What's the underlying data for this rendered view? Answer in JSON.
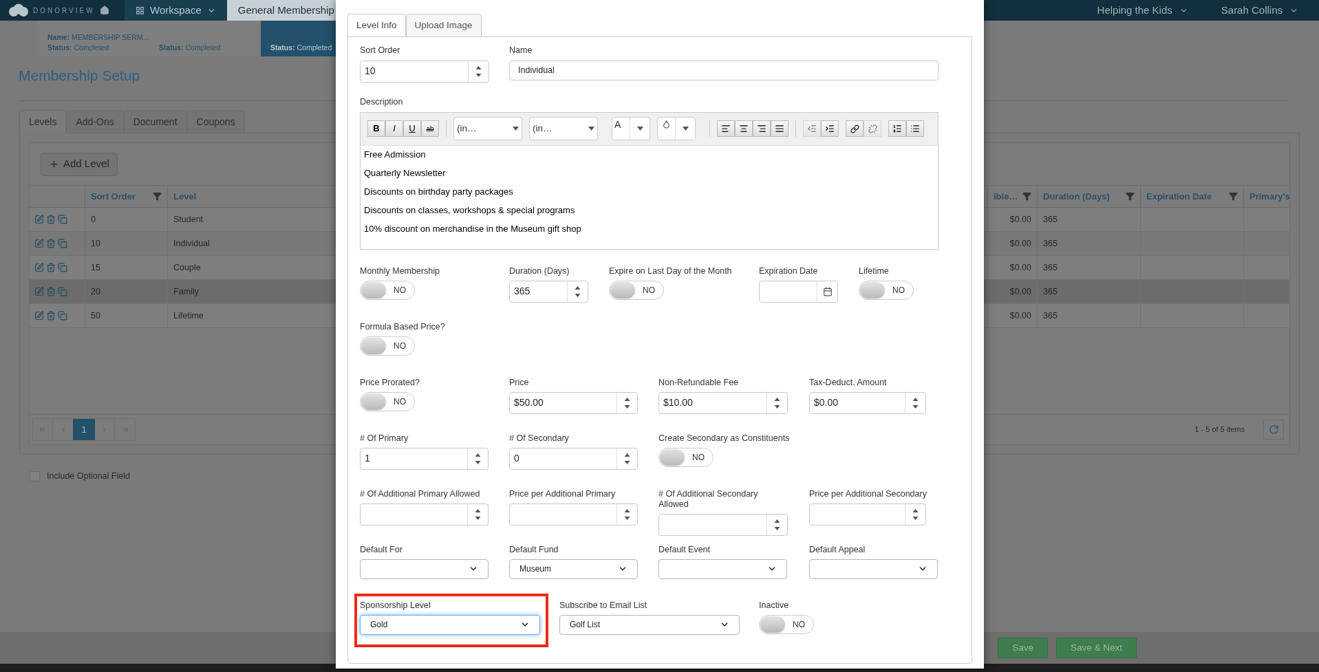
{
  "navbar": {
    "brand": "DONORVIEW",
    "items": [
      {
        "label": "Workspace",
        "selected": false
      },
      {
        "label": "General Membership",
        "selected": true
      }
    ],
    "org": "Helping the Kids",
    "user": "Sarah Collins"
  },
  "steps": [
    {
      "name_label": "Name:",
      "name": "MEMBERSHIP SERM…",
      "status_label": "Status:",
      "status": "Completed",
      "selected": false
    },
    {
      "status_label": "Status:",
      "status": "Completed",
      "selected": false
    },
    {
      "status_label": "Status:",
      "status": "Completed",
      "selected": true
    }
  ],
  "page_title": "Membership Setup",
  "page_tabs": [
    {
      "label": "Levels",
      "selected": true
    },
    {
      "label": "Add-Ons",
      "selected": false
    },
    {
      "label": "Document",
      "selected": false
    },
    {
      "label": "Coupons",
      "selected": false
    }
  ],
  "add_button": "Add Level",
  "table": {
    "columns": [
      {
        "label": "Sort Order",
        "filter": true
      },
      {
        "label": "Level"
      },
      {
        "label": "ible…",
        "filter": true
      },
      {
        "label": "Duration (Days)",
        "filter": true
      },
      {
        "label": "Expiration Date",
        "filter": true
      },
      {
        "label": "Primary's"
      }
    ],
    "rows": [
      {
        "sort_order": "0",
        "level": "Student",
        "amount": "$0.00",
        "duration": "365",
        "selected": false
      },
      {
        "sort_order": "10",
        "level": "Individual",
        "amount": "$0.00",
        "duration": "365",
        "selected": false
      },
      {
        "sort_order": "15",
        "level": "Couple",
        "amount": "$0.00",
        "duration": "365",
        "selected": false
      },
      {
        "sort_order": "20",
        "level": "Family",
        "amount": "$0.00",
        "duration": "365",
        "selected": true
      },
      {
        "sort_order": "50",
        "level": "Lifetime",
        "amount": "$0.00",
        "duration": "365",
        "selected": false
      }
    ],
    "pages": [
      {
        "label": "1",
        "selected": true
      }
    ],
    "pager_info": "1 - 5 of 5 items"
  },
  "include_optional": {
    "label": "Include Optional Field",
    "checked": false
  },
  "footer_buttons": [
    "Save",
    "Save & Next"
  ],
  "modal": {
    "tabs": [
      {
        "label": "Level Info",
        "selected": true
      },
      {
        "label": "Upload Image",
        "selected": false
      }
    ],
    "sort_order": {
      "label": "Sort Order",
      "value": "10"
    },
    "name": {
      "label": "Name",
      "value": "Individual"
    },
    "description": {
      "label": "Description",
      "format_buttons": [
        "B",
        "I",
        "U",
        "ab"
      ],
      "font_family": "(in…",
      "font_size": "(in…",
      "color_glyph": "A",
      "lines": [
        "Free Admission",
        "Quarterly Newsletter",
        "Discounts on birthday party packages",
        "Discounts on classes, workshops & special programs",
        "10% discount on merchandise in the Museum gift shop"
      ]
    },
    "rows": [
      [
        {
          "kind": "toggle",
          "label": "Monthly Membership",
          "on": false,
          "text": "NO"
        },
        {
          "kind": "number",
          "label": "Duration (Days)",
          "value": "365"
        },
        {
          "kind": "toggle",
          "label": "Expire on Last Day of the Month",
          "on": false,
          "text": "NO"
        },
        {
          "kind": "date",
          "label": "Expiration Date"
        },
        {
          "kind": "toggle",
          "label": "Lifetime",
          "on": false,
          "text": "NO"
        }
      ],
      [
        {
          "kind": "toggle",
          "label": "Formula Based Price?",
          "on": false,
          "text": "NO"
        }
      ],
      [
        {
          "kind": "toggle",
          "label": "Price Prorated?",
          "on": false,
          "text": "NO"
        },
        {
          "kind": "number",
          "label": "Price",
          "value": "$50.00"
        },
        {
          "kind": "number",
          "label": "Non-Refundable Fee",
          "value": "$10.00"
        },
        {
          "kind": "number",
          "label": "Tax-Deduct. Amount",
          "value": "$0.00"
        }
      ],
      [
        {
          "kind": "number",
          "label": "# Of Primary",
          "value": "1"
        },
        {
          "kind": "number",
          "label": "# Of Secondary",
          "value": "0"
        },
        {
          "kind": "toggle",
          "label": "Create Secondary as Constituents",
          "on": false,
          "text": "NO"
        }
      ],
      [
        {
          "kind": "number",
          "label": "# Of Additional Primary Allowed"
        },
        {
          "kind": "number",
          "label": "Price per Additional Primary"
        },
        {
          "kind": "number",
          "label": "# Of Additional Secondary Allowed"
        },
        {
          "kind": "number",
          "label": "Price per Additional Secondary"
        }
      ],
      [
        {
          "kind": "select",
          "label": "Default For"
        },
        {
          "kind": "select",
          "label": "Default Fund",
          "value": "Museum"
        },
        {
          "kind": "select",
          "label": "Default Event"
        },
        {
          "kind": "select",
          "label": "Default Appeal"
        }
      ],
      [
        {
          "kind": "select",
          "label": "Sponsorship Level",
          "value": "Gold",
          "highlighted": true
        },
        {
          "kind": "select",
          "label": "Subscribe to Email List",
          "value": "Golf List"
        },
        {
          "kind": "toggle",
          "label": "Inactive",
          "on": false,
          "text": "NO"
        }
      ]
    ]
  }
}
